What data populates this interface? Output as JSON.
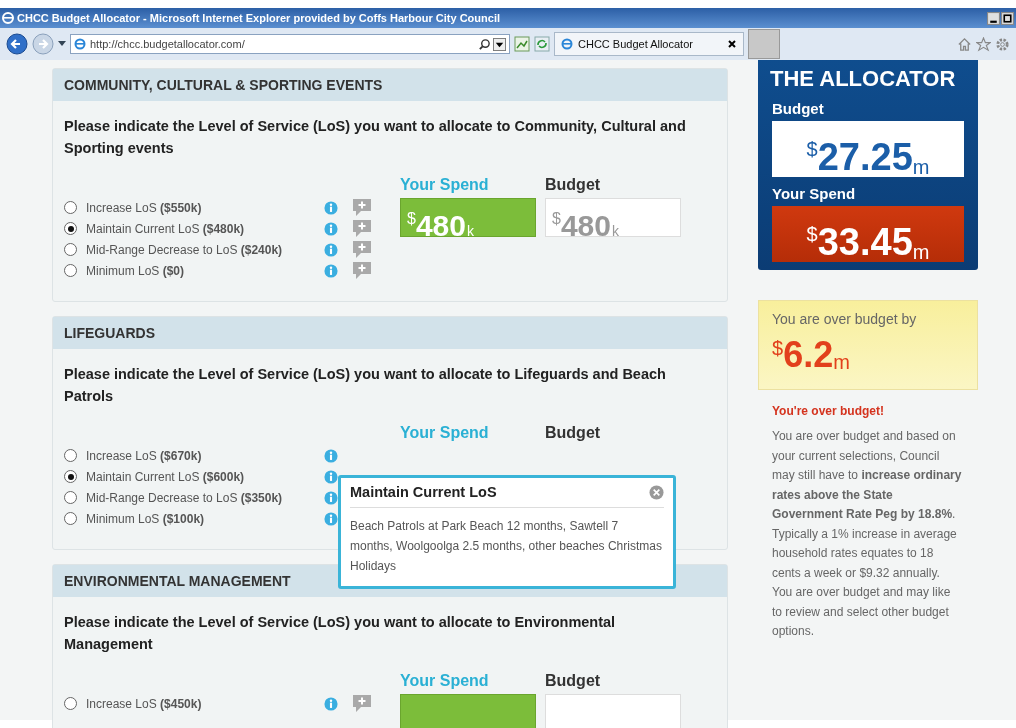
{
  "browser": {
    "title": "CHCC Budget Allocator - Microsoft Internet Explorer provided by Coffs Harbour City Council",
    "address": "http://chcc.budgetallocator.com/",
    "tab": "CHCC Budget Allocator"
  },
  "sections": [
    {
      "heading": "COMMUNITY, CULTURAL & SPORTING EVENTS",
      "question": "Please indicate the Level of Service (LoS) you want to allocate to Community, Cultural and Sporting events",
      "comment_buttons": true,
      "options": [
        {
          "label": "Increase LoS **($550k)**",
          "selected": false
        },
        {
          "label": "Maintain Current LoS **($480k)**",
          "selected": true
        },
        {
          "label": "Mid-Range Decrease to LoS **($240k)**",
          "selected": false
        },
        {
          "label": "Minimum LoS **($0)**",
          "selected": false
        }
      ],
      "spend": {
        "label": "Your Spend",
        "currency": "$",
        "value": "480",
        "unit": "k"
      },
      "budget": {
        "label": "Budget",
        "currency": "$",
        "value": "480",
        "unit": "k"
      }
    },
    {
      "heading": "LIFEGUARDS",
      "question": "Please indicate the Level of Service (LoS) you want to allocate to Lifeguards and Beach Patrols",
      "comment_buttons": false,
      "options": [
        {
          "label": "Increase LoS **($670k)**",
          "selected": false
        },
        {
          "label": "Maintain Current LoS **($600k)**",
          "selected": true
        },
        {
          "label": "Mid-Range Decrease to LoS **($350k)**",
          "selected": false
        },
        {
          "label": "Minimum LoS **($100k)**",
          "selected": false
        }
      ],
      "spend": {
        "label": "Your Spend"
      },
      "budget": {
        "label": "Budget"
      },
      "popup": {
        "title": "Maintain Current LoS",
        "text": "Beach Patrols at Park Beach 12 months, Sawtell 7 months, Woolgoolga 2.5 months, other beaches Christmas Holidays"
      }
    },
    {
      "heading": "ENVIRONMENTAL MANAGEMENT",
      "question": "Please indicate the Level of Service (LoS) you want to allocate to Environmental Management",
      "comment_buttons": true,
      "options": [
        {
          "label": "Increase LoS **($450k)**",
          "selected": false
        }
      ],
      "spend": {
        "label": "Your Spend"
      },
      "budget": {
        "label": "Budget"
      }
    }
  ],
  "allocator": {
    "title": "THE ALLOCATOR",
    "budget": {
      "label": "Budget",
      "currency": "$",
      "value": "27.25",
      "unit": "m"
    },
    "spend": {
      "label": "Your Spend",
      "currency": "$",
      "value": "33.45",
      "unit": "m"
    }
  },
  "over": {
    "text": "You are over budget by",
    "currency": "$",
    "value": "6.2",
    "unit": "m"
  },
  "warning": "You're over budget!",
  "message": "You are over budget and based on your current selections, Council may still have to **increase ordinary rates above the State Government Rate Peg by 18.8%**. Typically a 1% increase in average household rates equates to 18 cents a week or $9.32 annually. You are over budget and may like to review and select other budget options."
}
